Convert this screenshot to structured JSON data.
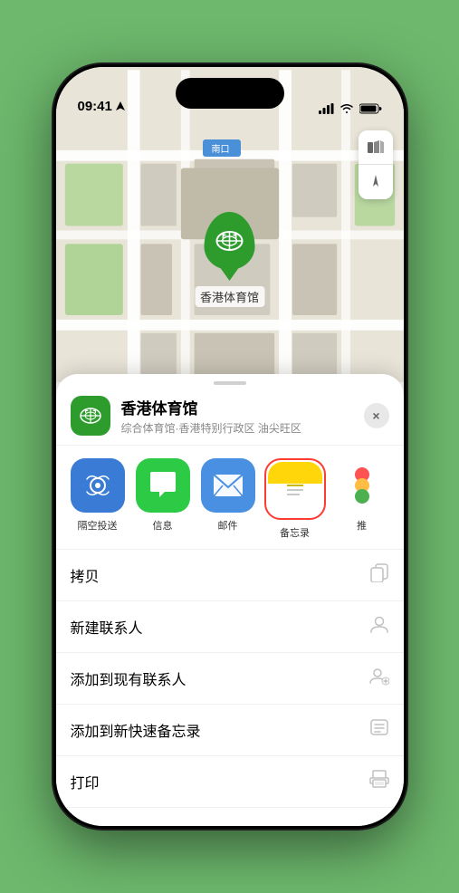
{
  "status_bar": {
    "time": "09:41",
    "location_arrow": true
  },
  "map": {
    "north_label": "南口",
    "controls": {
      "map_type_icon": "🗺",
      "location_icon": "➤"
    }
  },
  "venue": {
    "name": "香港体育馆",
    "subtitle": "综合体育馆·香港特别行政区 油尖旺区",
    "close_label": "×"
  },
  "share_items": [
    {
      "id": "airdrop",
      "label": "隔空投送",
      "icon": "📡",
      "type": "airdrop"
    },
    {
      "id": "messages",
      "label": "信息",
      "icon": "💬",
      "type": "messages"
    },
    {
      "id": "mail",
      "label": "邮件",
      "icon": "✉",
      "type": "mail"
    },
    {
      "id": "notes",
      "label": "备忘录",
      "icon": "📝",
      "type": "notes"
    },
    {
      "id": "more",
      "label": "推",
      "icon": "···",
      "type": "more"
    }
  ],
  "actions": [
    {
      "label": "拷贝",
      "icon": "copy"
    },
    {
      "label": "新建联系人",
      "icon": "person"
    },
    {
      "label": "添加到现有联系人",
      "icon": "person-add"
    },
    {
      "label": "添加到新快速备忘录",
      "icon": "note"
    },
    {
      "label": "打印",
      "icon": "print"
    }
  ]
}
